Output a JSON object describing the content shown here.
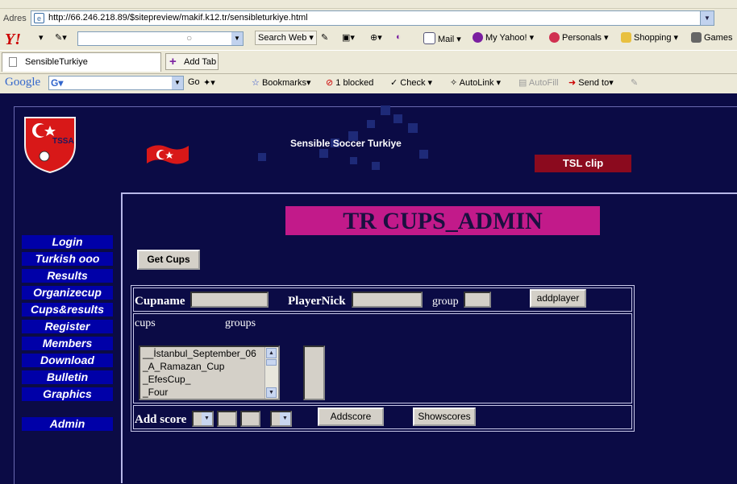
{
  "browser": {
    "address_label": "Adres",
    "url": "http://66.246.218.89/$sitepreview/makif.k12.tr/sensibleturkiye.html",
    "yahoo_toolbar": {
      "logo": "Y!",
      "search_button": "Search Web",
      "items": [
        "Mail",
        "My Yahoo!",
        "Personals",
        "Shopping",
        "Games"
      ]
    },
    "tabs": [
      {
        "label": "SensibleTurkiye"
      }
    ],
    "add_tab_label": "Add Tab",
    "google_toolbar": {
      "logo": "Google",
      "go_label": "Go",
      "bookmarks_label": "Bookmarks",
      "popup_blocked_label": "1 blocked",
      "check_label": "Check",
      "autolink_label": "AutoLink",
      "autofill_label": "AutoFill",
      "sendto_label": "Send to"
    }
  },
  "site": {
    "title": "Sensible Soccer Turkiye",
    "tsl_clip_label": "TSL clip",
    "logo_text": "TSSA",
    "nav": [
      "Login",
      "Turkish ooo",
      "Results",
      "Organizecup",
      "Cups&results",
      "Register",
      "Members",
      "Download",
      "Bulletin",
      "Graphics"
    ],
    "admin_label": "Admin"
  },
  "admin": {
    "title": "TR CUPS_ADMIN",
    "get_cups_label": "Get Cups",
    "cupname_label": "Cupname",
    "playernick_label": "PlayerNick",
    "group_label": "group",
    "addplayer_label": "addplayer",
    "cups_label": "cups",
    "groups_label": "groups",
    "cups_list": [
      "__İstanbul_September_06",
      "_A_Ramazan_Cup",
      "_EfesCup_",
      "_Four"
    ],
    "add_score_label": "Add score",
    "addscore_button": "Addscore",
    "showscores_button": "Showscores"
  },
  "colors": {
    "page_bg": "#0b0b45",
    "nav_bg": "#0000a8",
    "title_bg": "#c21a8a",
    "tsl_bg": "#8b0a1e"
  }
}
